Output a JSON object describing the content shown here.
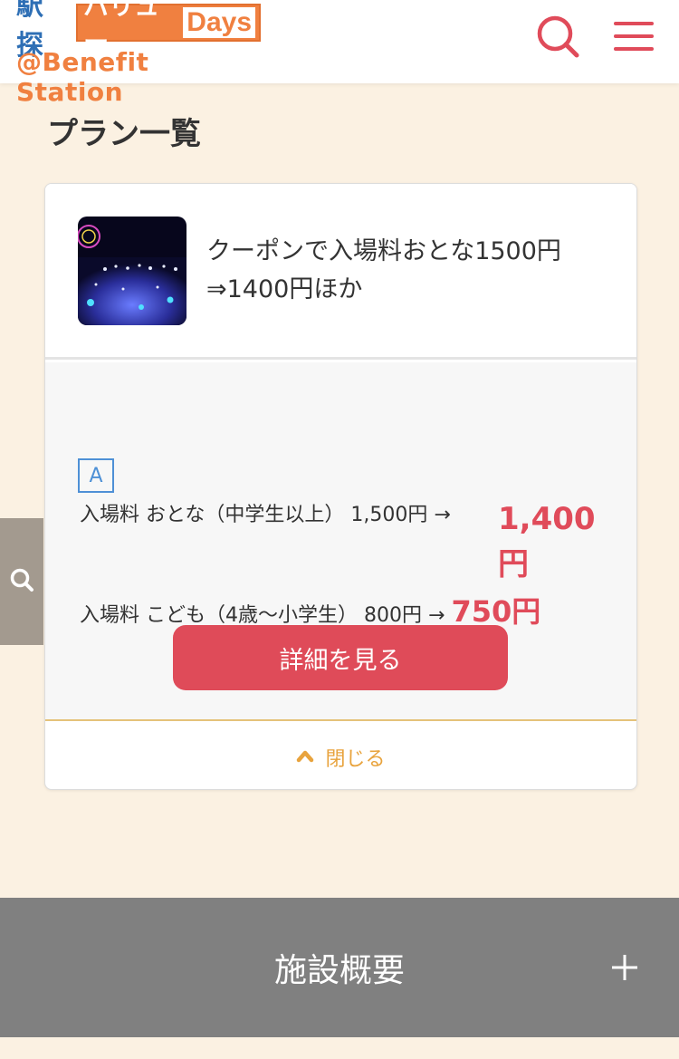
{
  "header": {
    "logo_ekitan": "駅探",
    "logo_value": "バリュー",
    "logo_days": "Days",
    "logo_benefit": "@Benefit Station",
    "search_icon": "search-icon",
    "menu_icon": "menu-icon",
    "accent_color": "#e04b5a"
  },
  "main": {
    "section_title": "プラン一覧"
  },
  "plan": {
    "title": "クーポンで入場料おとな1500円⇒1400円ほか",
    "badge": "A",
    "adult_label": "入場料 おとな（中学生以上）",
    "adult_regular": "1,500円",
    "adult_arrow": "→",
    "adult_price": "1,400円",
    "child_label": "入場料 こども（4歳〜小学生）",
    "child_regular": "800円",
    "child_arrow": "→",
    "child_price": "750円",
    "detail_button": "詳細を見る",
    "close_label": "閉じる"
  },
  "facility": {
    "title": "施設概要"
  },
  "colors": {
    "background": "#fbf1e2",
    "price_red": "#e04b5a",
    "close_orange": "#e8a33d",
    "facility_bar": "#808080"
  }
}
